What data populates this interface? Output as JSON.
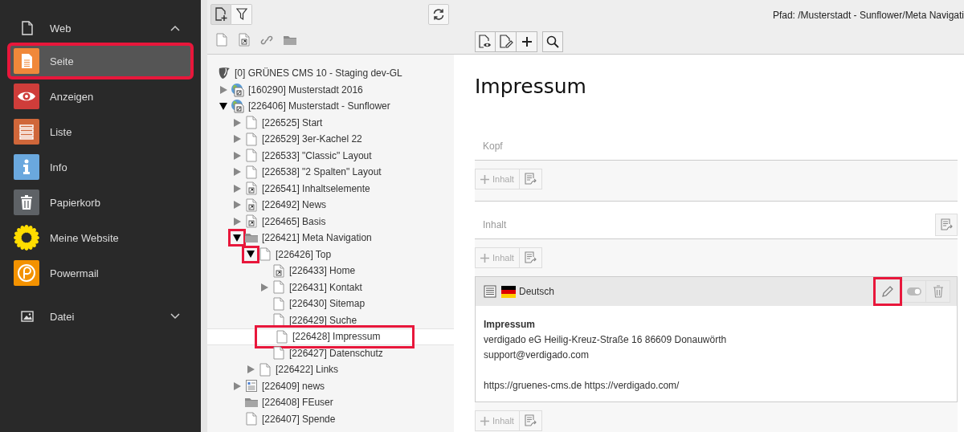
{
  "sidebar": {
    "groups": [
      {
        "label": "Web",
        "kind": "page",
        "expanded": true,
        "items": [
          {
            "label": "Seite",
            "kind": "page",
            "color": "#f0883a",
            "selected": true,
            "highlighted": true
          },
          {
            "label": "Anzeigen",
            "kind": "eye",
            "color": "#cf3d3a",
            "selected": false,
            "highlighted": false
          },
          {
            "label": "Liste",
            "kind": "list",
            "color": "#d0673a",
            "selected": false,
            "highlighted": false
          },
          {
            "label": "Info",
            "kind": "info",
            "color": "#6aa8de",
            "selected": false,
            "highlighted": false
          },
          {
            "label": "Papierkorb",
            "kind": "trash",
            "color": "#5e6266",
            "selected": false,
            "highlighted": false
          },
          {
            "label": "Meine Website",
            "kind": "sunflower",
            "color": "#ffdd00",
            "selected": false,
            "highlighted": false
          },
          {
            "label": "Powermail",
            "kind": "powermail",
            "color": "#f39200",
            "selected": false,
            "highlighted": false
          }
        ]
      },
      {
        "label": "Datei",
        "kind": "image",
        "expanded": false
      }
    ]
  },
  "tree": {
    "nodes": [
      {
        "label": "[0] GRÜNES CMS 10 - Staging dev-GL",
        "kind": "root",
        "selected": false,
        "highlighted": false,
        "children": [
          {
            "label": "[160290] Musterstadt 2016",
            "kind": "site",
            "has_children": true,
            "expanded": false,
            "selected": false,
            "highlighted": false
          },
          {
            "label": "[226406] Musterstadt - Sunflower",
            "kind": "site",
            "has_children": true,
            "expanded": true,
            "selected": false,
            "highlighted": false,
            "children": [
              {
                "label": "[226525] Start",
                "kind": "page",
                "has_children": true,
                "expanded": false,
                "selected": false,
                "highlighted": false
              },
              {
                "label": "[226529] 3er-Kachel 22",
                "kind": "page",
                "has_children": true,
                "expanded": false,
                "selected": false,
                "highlighted": false
              },
              {
                "label": "[226533] \"Classic\" Layout",
                "kind": "page",
                "has_children": true,
                "expanded": false,
                "selected": false,
                "highlighted": false
              },
              {
                "label": "[226538] \"2 Spalten\" Layout",
                "kind": "page",
                "has_children": true,
                "expanded": false,
                "selected": false,
                "highlighted": false
              },
              {
                "label": "[226541] Inhaltselemente",
                "kind": "shortcut",
                "has_children": true,
                "expanded": false,
                "selected": false,
                "highlighted": false
              },
              {
                "label": "[226492] News",
                "kind": "shortcut",
                "has_children": true,
                "expanded": false,
                "selected": false,
                "highlighted": false
              },
              {
                "label": "[226465] Basis",
                "kind": "shortcut",
                "has_children": true,
                "expanded": false,
                "selected": false,
                "highlighted": false
              },
              {
                "label": "[226421] Meta Navigation",
                "kind": "folder",
                "has_children": true,
                "expanded": true,
                "selected": false,
                "highlighted": true,
                "children": [
                  {
                    "label": "[226426] Top",
                    "kind": "page",
                    "has_children": true,
                    "expanded": true,
                    "selected": false,
                    "highlighted": true,
                    "children": [
                      {
                        "label": "[226433] Home",
                        "kind": "shortcut",
                        "has_children": false,
                        "selected": false,
                        "highlighted": false
                      },
                      {
                        "label": "[226431] Kontakt",
                        "kind": "page",
                        "has_children": true,
                        "expanded": false,
                        "selected": false,
                        "highlighted": false
                      },
                      {
                        "label": "[226430] Sitemap",
                        "kind": "page",
                        "has_children": false,
                        "selected": false,
                        "highlighted": false
                      },
                      {
                        "label": "[226429] Suche",
                        "kind": "page",
                        "has_children": false,
                        "selected": false,
                        "highlighted": false
                      },
                      {
                        "label": "[226428] Impressum",
                        "kind": "page",
                        "has_children": false,
                        "selected": true,
                        "highlighted": true
                      },
                      {
                        "label": "[226427] Datenschutz",
                        "kind": "page",
                        "has_children": false,
                        "selected": false,
                        "highlighted": false
                      }
                    ]
                  },
                  {
                    "label": "[226422] Links",
                    "kind": "page",
                    "has_children": true,
                    "expanded": false,
                    "selected": false,
                    "highlighted": false
                  }
                ]
              },
              {
                "label": "[226409] news",
                "kind": "news",
                "has_children": true,
                "expanded": false,
                "selected": false,
                "highlighted": false
              },
              {
                "label": "[226408] FEuser",
                "kind": "folder",
                "has_children": false,
                "selected": false,
                "highlighted": false
              },
              {
                "label": "[226407] Spende",
                "kind": "page",
                "has_children": false,
                "selected": false,
                "highlighted": false
              }
            ]
          }
        ]
      }
    ]
  },
  "content": {
    "path": "Pfad: /Musterstadt - Sunflower/Meta Navigati",
    "title": "Impressum",
    "sections": [
      {
        "label": "Kopf",
        "header_button": false,
        "blocks": [
          {
            "kind": "add",
            "label": "Inhalt"
          }
        ]
      },
      {
        "label": "Inhalt",
        "header_button": true,
        "blocks": [
          {
            "kind": "add",
            "label": "Inhalt"
          },
          {
            "kind": "element",
            "language": "Deutsch",
            "visible": true,
            "edit_highlighted": true,
            "heading": "Impressum",
            "paragraphs": [
              [
                "verdigado eG Heilig-Kreuz-Straße 16 86609 Donauwörth",
                "support@verdigado.com"
              ],
              [
                "https://gruenes-cms.de https://verdigado.com/"
              ]
            ]
          },
          {
            "kind": "add",
            "label": "Inhalt"
          }
        ]
      }
    ]
  }
}
